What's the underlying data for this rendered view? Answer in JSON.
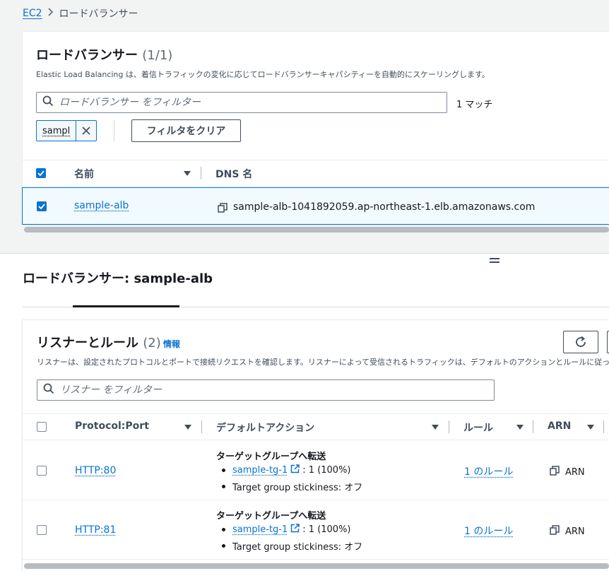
{
  "breadcrumb": {
    "root": "EC2",
    "current": "ロードバランサー"
  },
  "panel1": {
    "title": "ロードバランサー",
    "count": "(1/1)",
    "description": "Elastic Load Balancing は、着信トラフィックの変化に応じてロードバランサーキャパシティーを自動的にスケーリングします。",
    "filter_placeholder": "ロードバランサー をフィルター",
    "match_text": "1 マッチ",
    "token_value": "sampl",
    "clear_button": "フィルタをクリア",
    "columns": {
      "name": "名前",
      "dns": "DNS 名"
    },
    "rows": [
      {
        "name": "sample-alb",
        "dns": "sample-alb-1041892059.ap-northeast-1.elb.amazonaws.com",
        "checked": true
      }
    ]
  },
  "detail": {
    "title": "ロードバランサー: sample-alb"
  },
  "listeners": {
    "title": "リスナーとルール",
    "count": "(2)",
    "info": "情報",
    "description": "リスナーは、設定されたプロトコルとポートで接続リクエストを確認します。リスナーによって受信されるトラフィックは、デフォルトのアクションとルールに従ってルーティングされます。",
    "filter_placeholder": "リスナー をフィルター",
    "columns": {
      "protocol": "Protocol:Port",
      "action": "デフォルトアクション",
      "rule": "ルール",
      "arn": "ARN"
    },
    "rows": [
      {
        "protocol": "HTTP:80",
        "action_title": "ターゲットグループへ転送",
        "tg_name": "sample-tg-1",
        "tg_weight": ": 1 (100%)",
        "stickiness": "Target group stickiness: オフ",
        "rules": "1 のルール",
        "arn": "ARN"
      },
      {
        "protocol": "HTTP:81",
        "action_title": "ターゲットグループへ転送",
        "tg_name": "sample-tg-1",
        "tg_weight": ": 1 (100%)",
        "stickiness": "Target group stickiness: オフ",
        "rules": "1 のルール",
        "arn": "ARN"
      }
    ]
  },
  "colors": {
    "accent": "#0972d3",
    "text": "#16191f",
    "muted": "#5f6b7a",
    "selected_row": "#f1faff"
  }
}
